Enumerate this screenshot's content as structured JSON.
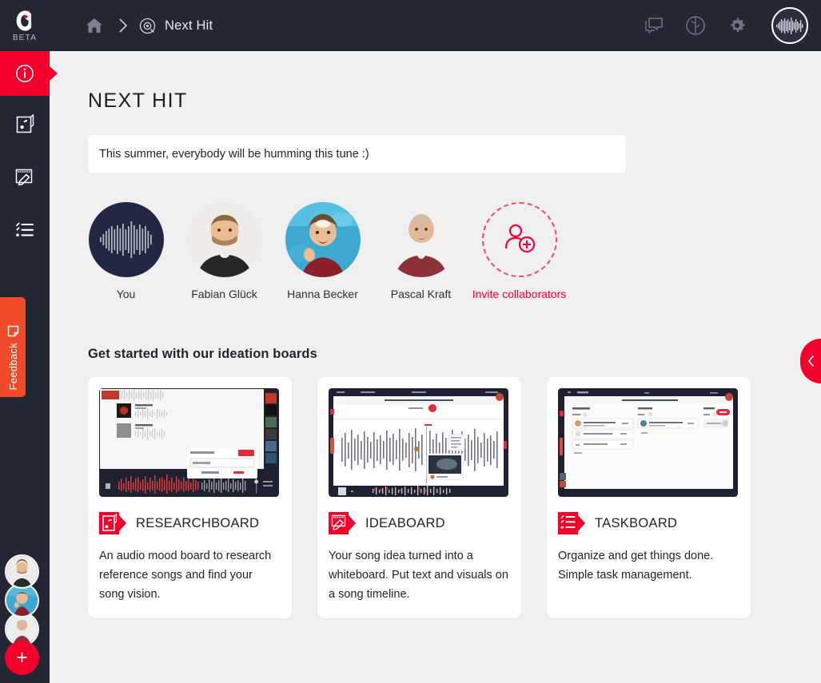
{
  "theme": {
    "header_bg": "#232733",
    "accent_red": "#f2002b",
    "feedback_orange": "#f04a2a",
    "page_bg": "#f0f0f0",
    "card_bg": "#ffffff",
    "text_dark": "#20242e"
  },
  "header": {
    "logo_name": "complete-logo",
    "beta_label": "BETA",
    "breadcrumb": {
      "home_icon": "home-icon",
      "separator_icon": "chevron-right-icon",
      "project_icon": "disc-icon",
      "project_label": "Next Hit"
    },
    "actions": [
      {
        "name": "chat-icon",
        "label": "Chat"
      },
      {
        "name": "brain-icon",
        "label": "Insights"
      },
      {
        "name": "gear-icon",
        "label": "Settings"
      }
    ],
    "account_avatar": "waveform-avatar"
  },
  "sidebar": {
    "items": [
      {
        "name": "sidebar-item-info",
        "icon": "info-circle-icon",
        "label": "Info",
        "active": true
      },
      {
        "name": "sidebar-item-researchboard",
        "icon": "music-sheet-icon",
        "label": "Researchboard",
        "active": false
      },
      {
        "name": "sidebar-item-ideaboard",
        "icon": "whiteboard-pen-icon",
        "label": "Ideaboard",
        "active": false
      },
      {
        "name": "sidebar-item-taskboard",
        "icon": "task-list-icon",
        "label": "Taskboard",
        "active": false
      }
    ],
    "feedback": {
      "label": "Feedback",
      "icon": "feedback-note-icon"
    },
    "member_avatars": [
      {
        "name": "rail-avatar-fabian"
      },
      {
        "name": "rail-avatar-hanna"
      },
      {
        "name": "rail-avatar-pascal"
      }
    ],
    "add_member": {
      "label": "+",
      "name": "add-member-button"
    }
  },
  "main": {
    "title": "NEXT HIT",
    "description": "This summer, everybody will be humming this tune :)",
    "collaborators": [
      {
        "name": "You",
        "type": "waveform"
      },
      {
        "name": "Fabian Glück",
        "type": "photo"
      },
      {
        "name": "Hanna Becker",
        "type": "photo"
      },
      {
        "name": "Pascal Kraft",
        "type": "photo"
      },
      {
        "name": "Invite collaborators",
        "type": "invite",
        "icon": "add-person-icon"
      }
    ],
    "boards_heading": "Get started with our ideation boards",
    "boards": [
      {
        "title": "RESEARCHBOARD",
        "description": "An audio mood board to research reference songs and find your song vision.",
        "badge_icon": "music-sheet-badge-icon",
        "thumb": "researchboard-thumbnail"
      },
      {
        "title": "IDEABOARD",
        "description": "Your song idea turned into a whiteboard. Put text and visuals on a song timeline.",
        "badge_icon": "whiteboard-pen-badge-icon",
        "thumb": "ideaboard-thumbnail"
      },
      {
        "title": "TASKBOARD",
        "description": "Organize and get things done. Simple task management.",
        "badge_icon": "task-list-badge-icon",
        "thumb": "taskboard-thumbnail"
      }
    ]
  },
  "right_panel_tab": {
    "icon": "chevron-left-icon",
    "name": "open-right-panel"
  }
}
